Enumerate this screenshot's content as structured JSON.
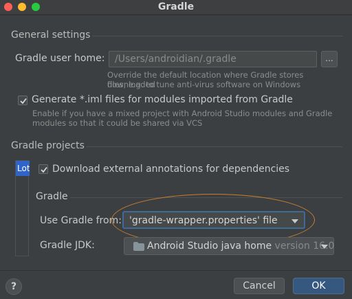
{
  "window": {
    "title": "Gradle"
  },
  "general": {
    "heading": "General settings",
    "gradle_home_label": "Gradle user home:",
    "gradle_home_value": "/Users/androidian/.gradle",
    "browse_label": "...",
    "gradle_home_hint_1": "Override the default location where Gradle stores downloaded",
    "gradle_home_hint_2": "files, e.g. to tune anti-virus software on Windows",
    "generate_iml_label": "Generate *.iml files for modules imported from Gradle",
    "generate_iml_checked": true,
    "generate_iml_hint_1": "Enable if you have a mixed project with Android Studio modules and Gradle",
    "generate_iml_hint_2": "modules so that it could be shared via VCS"
  },
  "projects": {
    "heading": "Gradle projects",
    "list_item": "Lot",
    "download_annotations_label": "Download external annotations for dependencies",
    "download_annotations_checked": true,
    "gradle_subheading": "Gradle",
    "use_gradle_from_label": "Use Gradle from:",
    "use_gradle_from_value": "'gradle-wrapper.properties' file",
    "jdk_label": "Gradle JDK:",
    "jdk_value": "Android Studio java home",
    "jdk_version": "version 16.0"
  },
  "buttons": {
    "help": "?",
    "cancel": "Cancel",
    "ok": "OK"
  },
  "colors": {
    "accent": "#2f65ca",
    "ok_button": "#365880",
    "highlight_oval": "#c8802e",
    "background": "#3c3f41"
  }
}
